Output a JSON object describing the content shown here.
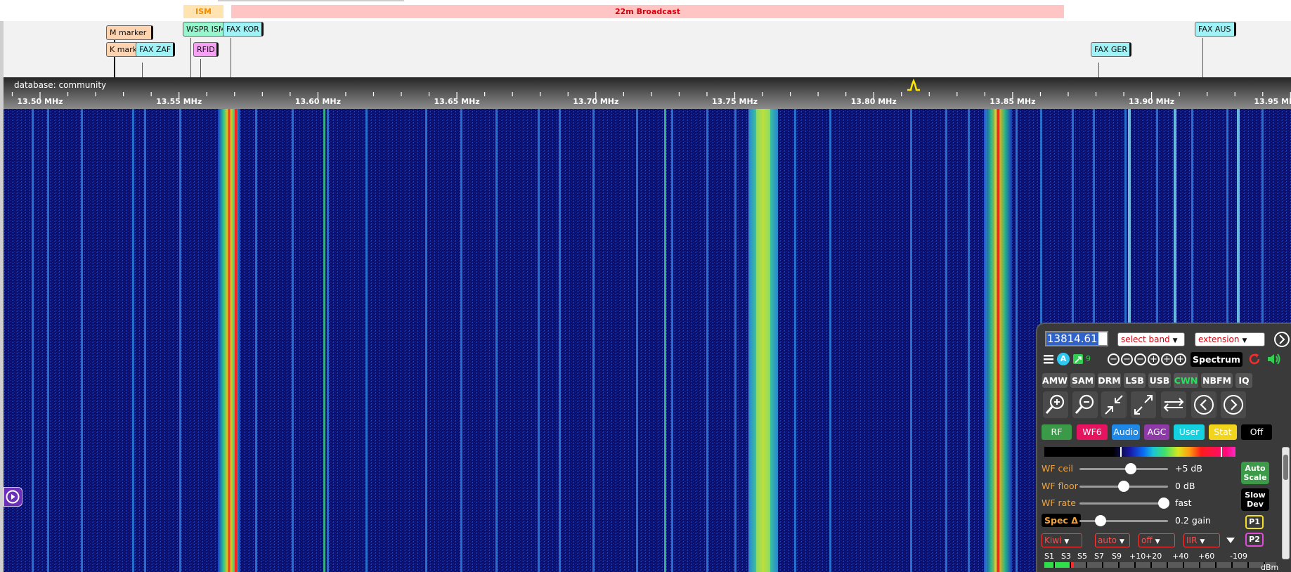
{
  "bands": [
    {
      "label": "ISM"
    },
    {
      "label": "22m Broadcast"
    }
  ],
  "markers": {
    "m_marker": "M marker",
    "k_marker": "K marker",
    "fax_zaf": "FAX ZAF",
    "wspr_ism": "WSPR ISM",
    "fax_kor": "FAX KOR",
    "rfid": "RFID",
    "fax_ger": "FAX GER",
    "fax_aus": "FAX AUS"
  },
  "scale": {
    "database_label": "database: community",
    "ticks": [
      "13.50 MHz",
      "13.55 MHz",
      "13.60 MHz",
      "13.65 MHz",
      "13.70 MHz",
      "13.75 MHz",
      "13.80 MHz",
      "13.85 MHz",
      "13.90 MHz",
      "13.95 MHz"
    ]
  },
  "panel": {
    "frequency": "13814.61",
    "select_band": "select band",
    "extension": "extension",
    "counter": "9",
    "spectrum_label": "Spectrum",
    "modes": [
      {
        "label": "AMW",
        "active": false
      },
      {
        "label": "SAM",
        "active": false
      },
      {
        "label": "DRM",
        "active": false
      },
      {
        "label": "LSB",
        "active": false
      },
      {
        "label": "USB",
        "active": false
      },
      {
        "label": "CWN",
        "active": true
      },
      {
        "label": "NBFM",
        "active": false
      },
      {
        "label": "IQ",
        "active": false
      }
    ],
    "tabs": [
      {
        "label": "RF",
        "color": "#3b9a47"
      },
      {
        "label": "WF6",
        "color": "#e8135f"
      },
      {
        "label": "Audio",
        "color": "#1d88e5"
      },
      {
        "label": "AGC",
        "color": "#8e3aa6"
      },
      {
        "label": "User",
        "color": "#15d1e0"
      },
      {
        "label": "Stat",
        "color": "#f2d41c"
      },
      {
        "label": "Off",
        "color": "#000000"
      }
    ],
    "sliders": [
      {
        "label": "WF ceil",
        "value": "+5 dB",
        "level": 0.58
      },
      {
        "label": "WF floor",
        "value": "0 dB",
        "level": 0.5
      },
      {
        "label": "WF rate",
        "value": "fast",
        "level": 0.95
      },
      {
        "label": "Spec Δ",
        "value": "0.2 gain",
        "level": 0.24
      }
    ],
    "auto_scale": "Auto Scale",
    "slow_dev": "Slow Dev",
    "p1": "P1",
    "p2": "P2",
    "dropdowns": [
      "Kiwi",
      "auto",
      "off",
      "IIR"
    ],
    "smeter_labels": [
      "S1",
      "S3",
      "S5",
      "S7",
      "S9",
      "+10",
      "+20",
      "+40",
      "+60",
      "-109"
    ],
    "smeter_unit": "dBm",
    "smeter_level": 0.11
  },
  "colors": {
    "waterfall_bg": "#0b0f6e",
    "accent_green": "#25e05a",
    "label_orange": "#f2a33a",
    "alert_red": "#d8000c"
  }
}
